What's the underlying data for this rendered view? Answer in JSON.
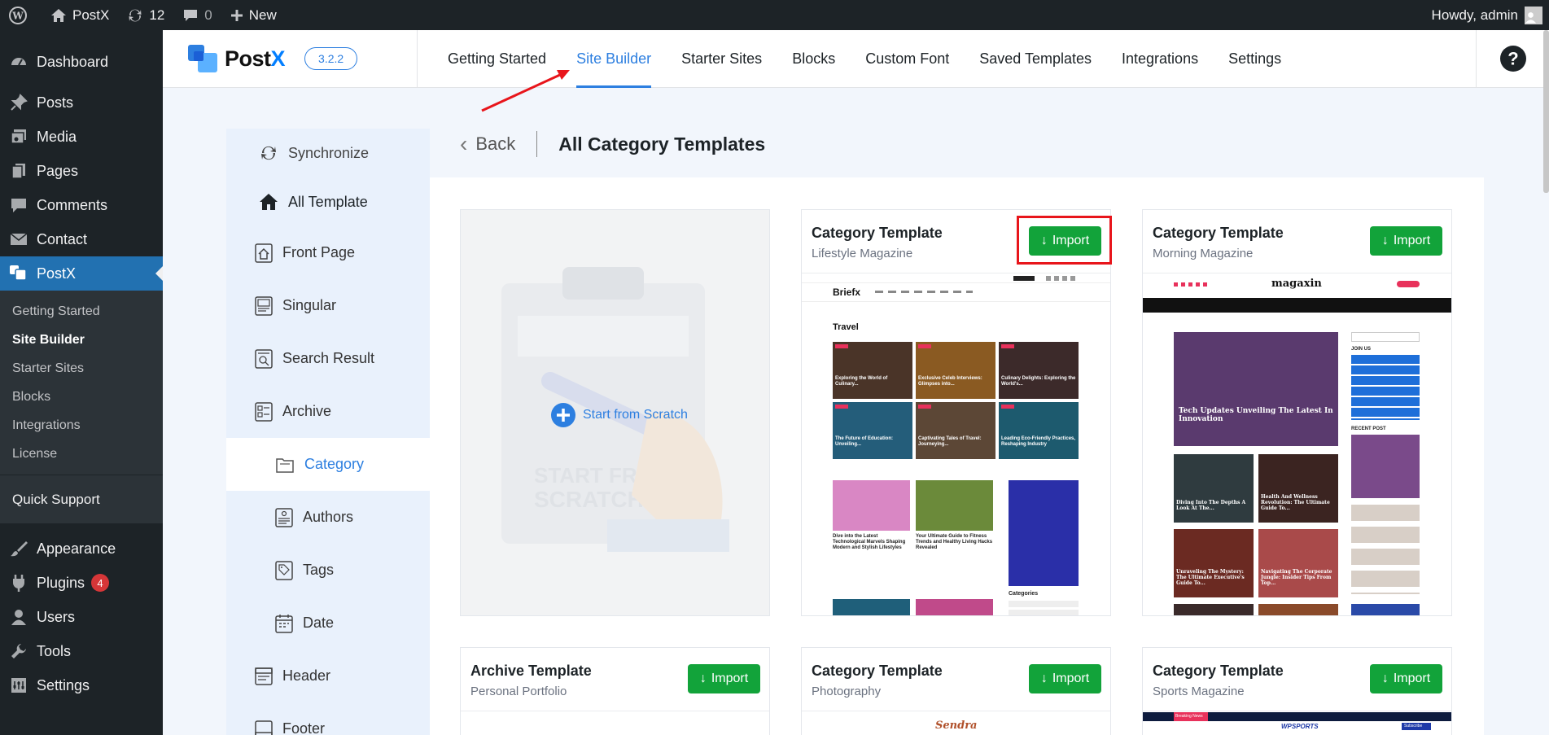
{
  "admin_bar": {
    "site_name": "PostX",
    "updates_count": "12",
    "comments_count": "0",
    "new_label": "New",
    "howdy": "Howdy, admin"
  },
  "sidebar": {
    "items": [
      {
        "label": "Dashboard",
        "icon": "dashboard-icon"
      },
      {
        "label": "Posts",
        "icon": "pin-icon"
      },
      {
        "label": "Media",
        "icon": "media-icon"
      },
      {
        "label": "Pages",
        "icon": "pages-icon"
      },
      {
        "label": "Comments",
        "icon": "comment-icon"
      },
      {
        "label": "Contact",
        "icon": "mail-icon"
      },
      {
        "label": "PostX",
        "icon": "postx-icon"
      }
    ],
    "submenu": [
      "Getting Started",
      "Site Builder",
      "Starter Sites",
      "Blocks",
      "Integrations",
      "License"
    ],
    "quick_support": "Quick Support",
    "lower_items": [
      {
        "label": "Appearance",
        "icon": "brush-icon"
      },
      {
        "label": "Plugins",
        "icon": "plugin-icon",
        "badge": "4"
      },
      {
        "label": "Users",
        "icon": "users-icon"
      },
      {
        "label": "Tools",
        "icon": "wrench-icon"
      },
      {
        "label": "Settings",
        "icon": "settings-icon"
      }
    ]
  },
  "header": {
    "logo": "PostX",
    "version": "3.2.2",
    "tabs": [
      "Getting Started",
      "Site Builder",
      "Starter Sites",
      "Blocks",
      "Custom Font",
      "Saved Templates",
      "Integrations",
      "Settings"
    ],
    "active_tab": "Site Builder",
    "help_icon": "help-icon"
  },
  "template_sidebar": {
    "sync": "Synchronize",
    "all_template": "All Template",
    "items": [
      "Front Page",
      "Singular",
      "Search Result",
      "Archive"
    ],
    "sub_items": [
      "Category",
      "Authors",
      "Tags",
      "Date"
    ],
    "after": [
      "Header",
      "Footer"
    ]
  },
  "main": {
    "back": "Back",
    "title": "All Category Templates",
    "scratch": {
      "label": "Start from Scratch",
      "ghost_line1": "START FROM",
      "ghost_line2": "SCRATCH"
    },
    "import_label": "Import",
    "cards": [
      {
        "title": "Category Template",
        "subtitle": "Lifestyle Magazine"
      },
      {
        "title": "Category Template",
        "subtitle": "Morning Magazine"
      },
      {
        "title": "Archive Template",
        "subtitle": "Personal Portfolio"
      },
      {
        "title": "Category Template",
        "subtitle": "Photography"
      },
      {
        "title": "Category Template",
        "subtitle": "Sports Magazine"
      }
    ],
    "preview_lifestyle": {
      "brand": "Briefx",
      "section": "Travel",
      "tiles": [
        "Exploring the World of Culinary...",
        "Exclusive Celeb Interviews: Glimpses into...",
        "Culinary Delights: Exploring the World's...",
        "The Future of Education: Unveiling...",
        "Captivating Tales of Travel: Journeying...",
        "Leading Eco-Friendly Practices, Reshaping Industry"
      ],
      "posts": [
        "Dive into the Latest Technological Marvels Shaping Modern and Stylish Lifestyles",
        "Your Ultimate Guide to Fitness Trends and Healthy Living Hacks Revealed"
      ],
      "side_heading": "Categories"
    },
    "preview_morning": {
      "brand": "magaxin",
      "hero": "Tech Updates Unveiling The Latest In Innovation",
      "tiles": [
        "Diving Into The Depths A Look At The...",
        "Health And Wellness Revolution: The Ultimate Guide To...",
        "Unraveling The Mystery: The Ultimate Executive's Guide To...",
        "Navigating The Corporate Jungle: Insider Tips From Top..."
      ],
      "join": "JOIN US",
      "recent": "RECENT POST"
    },
    "preview_photography": {
      "brand": "Sendra"
    },
    "preview_sports": {
      "brand": "WPSPORTS",
      "breaking": "Breaking News",
      "subscribe": "Subscribe"
    }
  },
  "colors": {
    "wp_dark": "#1d2327",
    "wp_blue": "#2271b1",
    "postx_blue": "#2d7fe0",
    "import_green": "#12a33a",
    "highlight_red": "#e8151b"
  }
}
